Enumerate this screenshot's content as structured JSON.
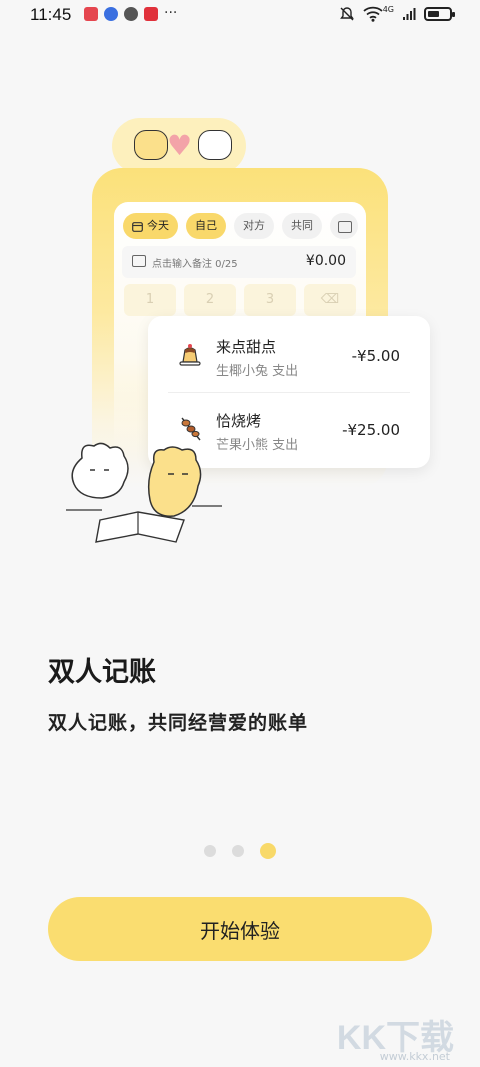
{
  "status_bar": {
    "time": "11:45",
    "network": "4G",
    "battery_level": 0.55
  },
  "illustration": {
    "tabs": [
      {
        "label": "今天",
        "active": true,
        "icon": "calendar-icon"
      },
      {
        "label": "自己",
        "active": true
      },
      {
        "label": "对方",
        "active": false
      },
      {
        "label": "共同",
        "active": false
      }
    ],
    "memo_placeholder": "点击输入备注 0/25",
    "amount": "¥0.00",
    "keys": [
      "1",
      "2",
      "3"
    ],
    "transactions": [
      {
        "title": "来点甜点",
        "subtitle": "生椰小兔 支出",
        "amount": "-¥5.00",
        "icon": "pudding-icon"
      },
      {
        "title": "恰烧烤",
        "subtitle": "芒果小熊 支出",
        "amount": "-¥25.00",
        "icon": "skewer-icon"
      }
    ]
  },
  "heading": "双人记账",
  "subheading": "双人记账，共同经营爱的账单",
  "pager": {
    "total": 3,
    "current": 3
  },
  "cta_label": "开始体验",
  "colors": {
    "accent": "#fadd70",
    "background": "#f7f7f7"
  }
}
